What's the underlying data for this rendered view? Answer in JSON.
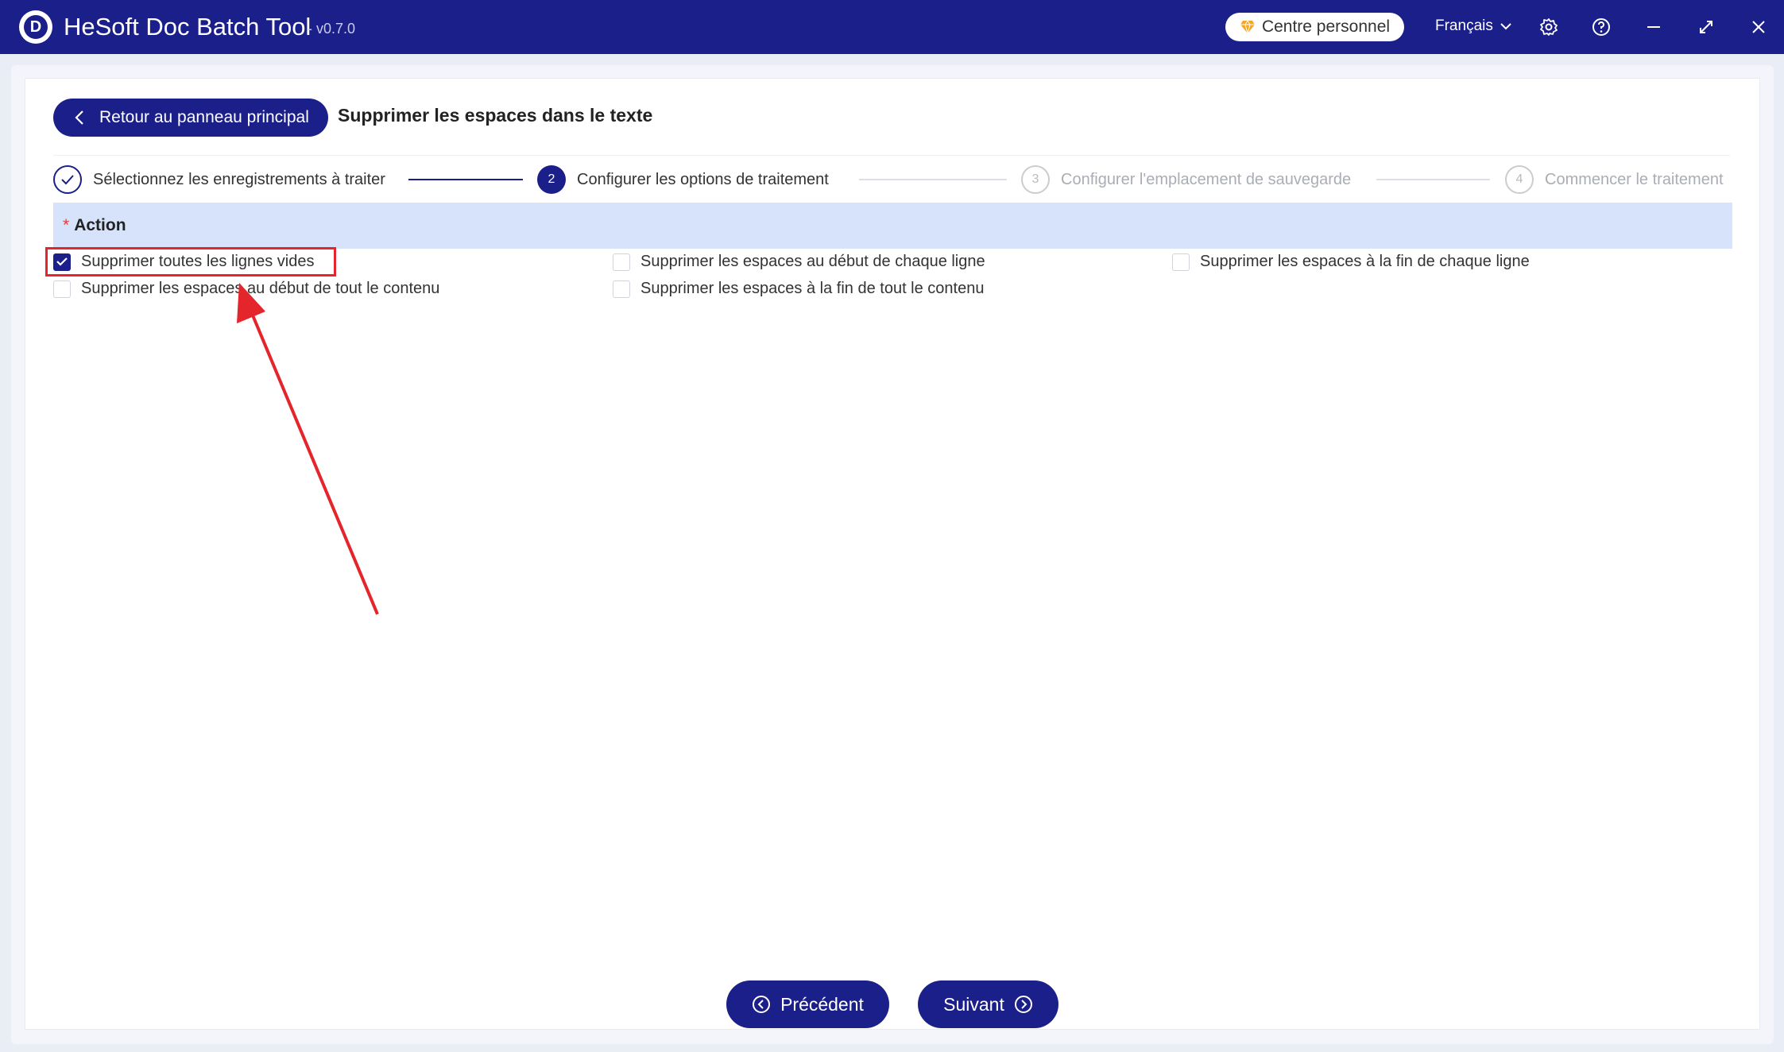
{
  "window": {
    "title": "HeSoft Doc Batch Tool",
    "version": "- v0.7.0",
    "logo_letter": "D",
    "personal_center": "Centre personnel",
    "language": "Français"
  },
  "header": {
    "back_label": "Retour au panneau principal",
    "page_title": "Supprimer les espaces dans le texte"
  },
  "steps": [
    {
      "num": "1",
      "label": "Sélectionnez les enregistrements à traiter",
      "state": "done"
    },
    {
      "num": "2",
      "label": "Configurer les options de traitement",
      "state": "active"
    },
    {
      "num": "3",
      "label": "Configurer l'emplacement de sauvegarde",
      "state": "todo"
    },
    {
      "num": "4",
      "label": "Commencer le traitement",
      "state": "todo"
    }
  ],
  "section": {
    "required_mark": "*",
    "title": "Action"
  },
  "options": [
    {
      "label": "Supprimer toutes les lignes vides",
      "checked": true
    },
    {
      "label": "Supprimer les espaces au début de chaque ligne",
      "checked": false
    },
    {
      "label": "Supprimer les espaces à la fin de chaque ligne",
      "checked": false
    },
    {
      "label": "Supprimer les espaces au début de tout le contenu",
      "checked": false
    },
    {
      "label": "Supprimer les espaces à la fin de tout le contenu",
      "checked": false
    }
  ],
  "footer": {
    "prev_label": "Précédent",
    "next_label": "Suivant"
  },
  "colors": {
    "primary": "#1b1f8a",
    "highlight": "#e4252b",
    "section_bg": "#d6e3fb",
    "diamond": "#f5a623"
  }
}
